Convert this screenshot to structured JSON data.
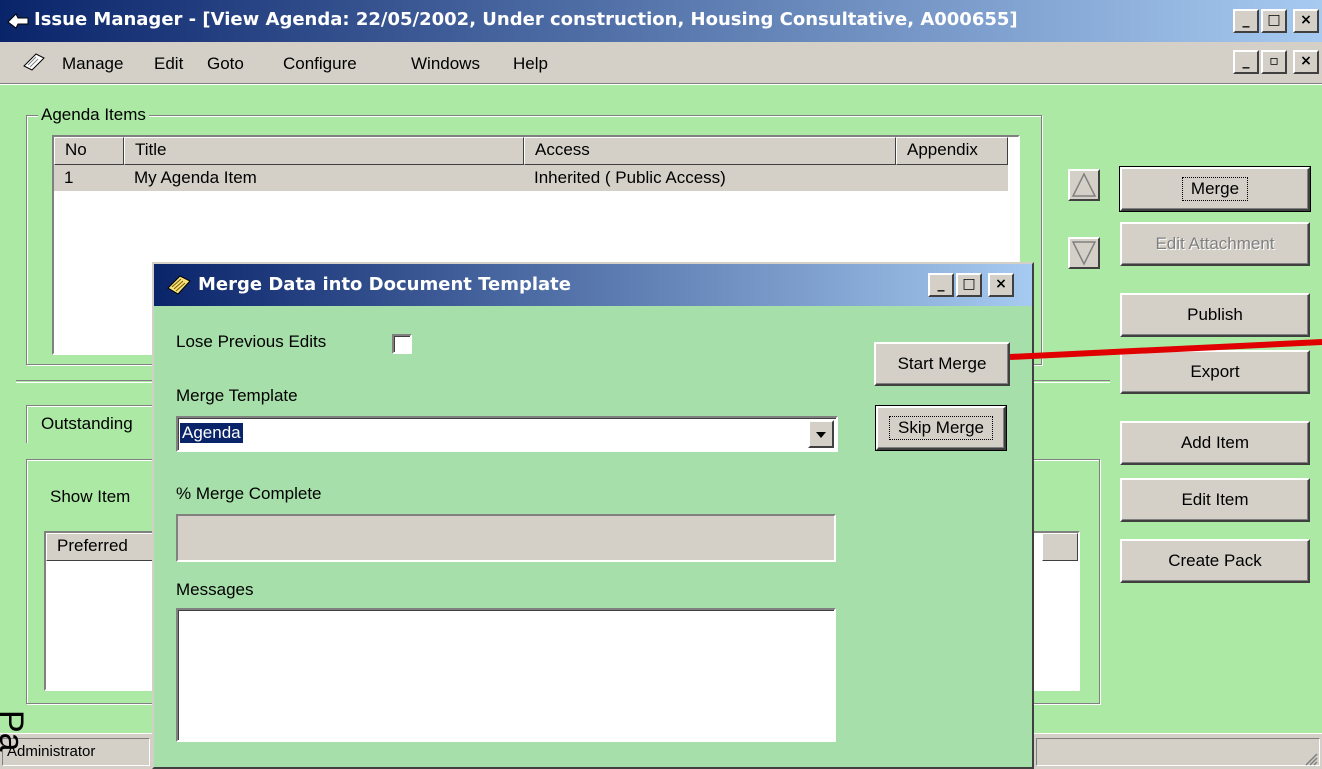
{
  "window": {
    "title": "Issue Manager - [View Agenda: 22/05/2002, Under construction, Housing Consultative, A000655]",
    "caption_buttons": [
      "_",
      "□",
      "×"
    ]
  },
  "menu": {
    "items": [
      {
        "label": "Manage"
      },
      {
        "label": "Edit"
      },
      {
        "label": "Goto"
      },
      {
        "label": "Configure"
      },
      {
        "label": "Windows"
      },
      {
        "label": "Help"
      }
    ]
  },
  "agenda_items": {
    "group_label": "Agenda Items",
    "columns": [
      "No",
      "Title",
      "Access",
      "Appendix"
    ],
    "rows": [
      {
        "no": "1",
        "title": "My Agenda Item",
        "access": "Inherited ( Public Access)",
        "appendix": ""
      }
    ]
  },
  "side_buttons": {
    "merge": "Merge",
    "edit_attachment": "Edit Attachment",
    "publish": "Publish",
    "export": "Export",
    "add_item": "Add Item",
    "edit_item": "Edit Item",
    "create_pack": "Create Pack"
  },
  "lower_panel": {
    "tab_label": "Outstanding",
    "show_items_label": "Show Item",
    "column_label": "Preferred"
  },
  "dialog": {
    "title": "Merge Data into Document Template",
    "lose_previous_edits_label": "Lose Previous Edits",
    "lose_previous_edits_checked": false,
    "merge_template_label": "Merge Template",
    "merge_template_value": "Agenda",
    "merge_complete_label": "% Merge Complete",
    "merge_complete_value": 0,
    "messages_label": "Messages",
    "messages_value": "",
    "start_merge": "Start Merge",
    "skip_merge": "Skip Merge"
  },
  "status_bar": {
    "user": "Administrator",
    "overlay_text": "Pa"
  },
  "colors": {
    "title_start": "#0a246a",
    "title_end": "#a6caf0",
    "main_bg": "#ace9a5",
    "dialog_bg": "#a6dfa9",
    "annotation_red": "#e00000"
  }
}
